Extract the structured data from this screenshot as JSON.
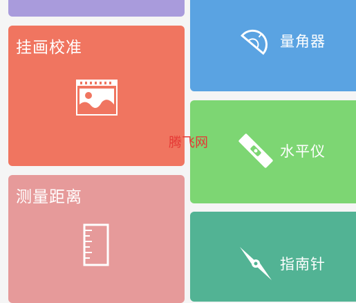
{
  "colors": {
    "purple": "#a99bdc",
    "calibrate": "#f07560",
    "distance": "#e69a9a",
    "protractor": "#5aa3e2",
    "level": "#7dd673",
    "compass": "#52b394",
    "watermark": "#e53935"
  },
  "left_tiles": [
    {
      "title": "挂画校准",
      "icon": "image-frame-icon"
    },
    {
      "title": "测量距离",
      "icon": "ruler-icon"
    }
  ],
  "right_tiles": [
    {
      "label": "量角器",
      "icon": "protractor-icon"
    },
    {
      "label": "水平仪",
      "icon": "spirit-level-icon"
    },
    {
      "label": "指南针",
      "icon": "compass-icon"
    }
  ],
  "watermark": "腾飞网"
}
